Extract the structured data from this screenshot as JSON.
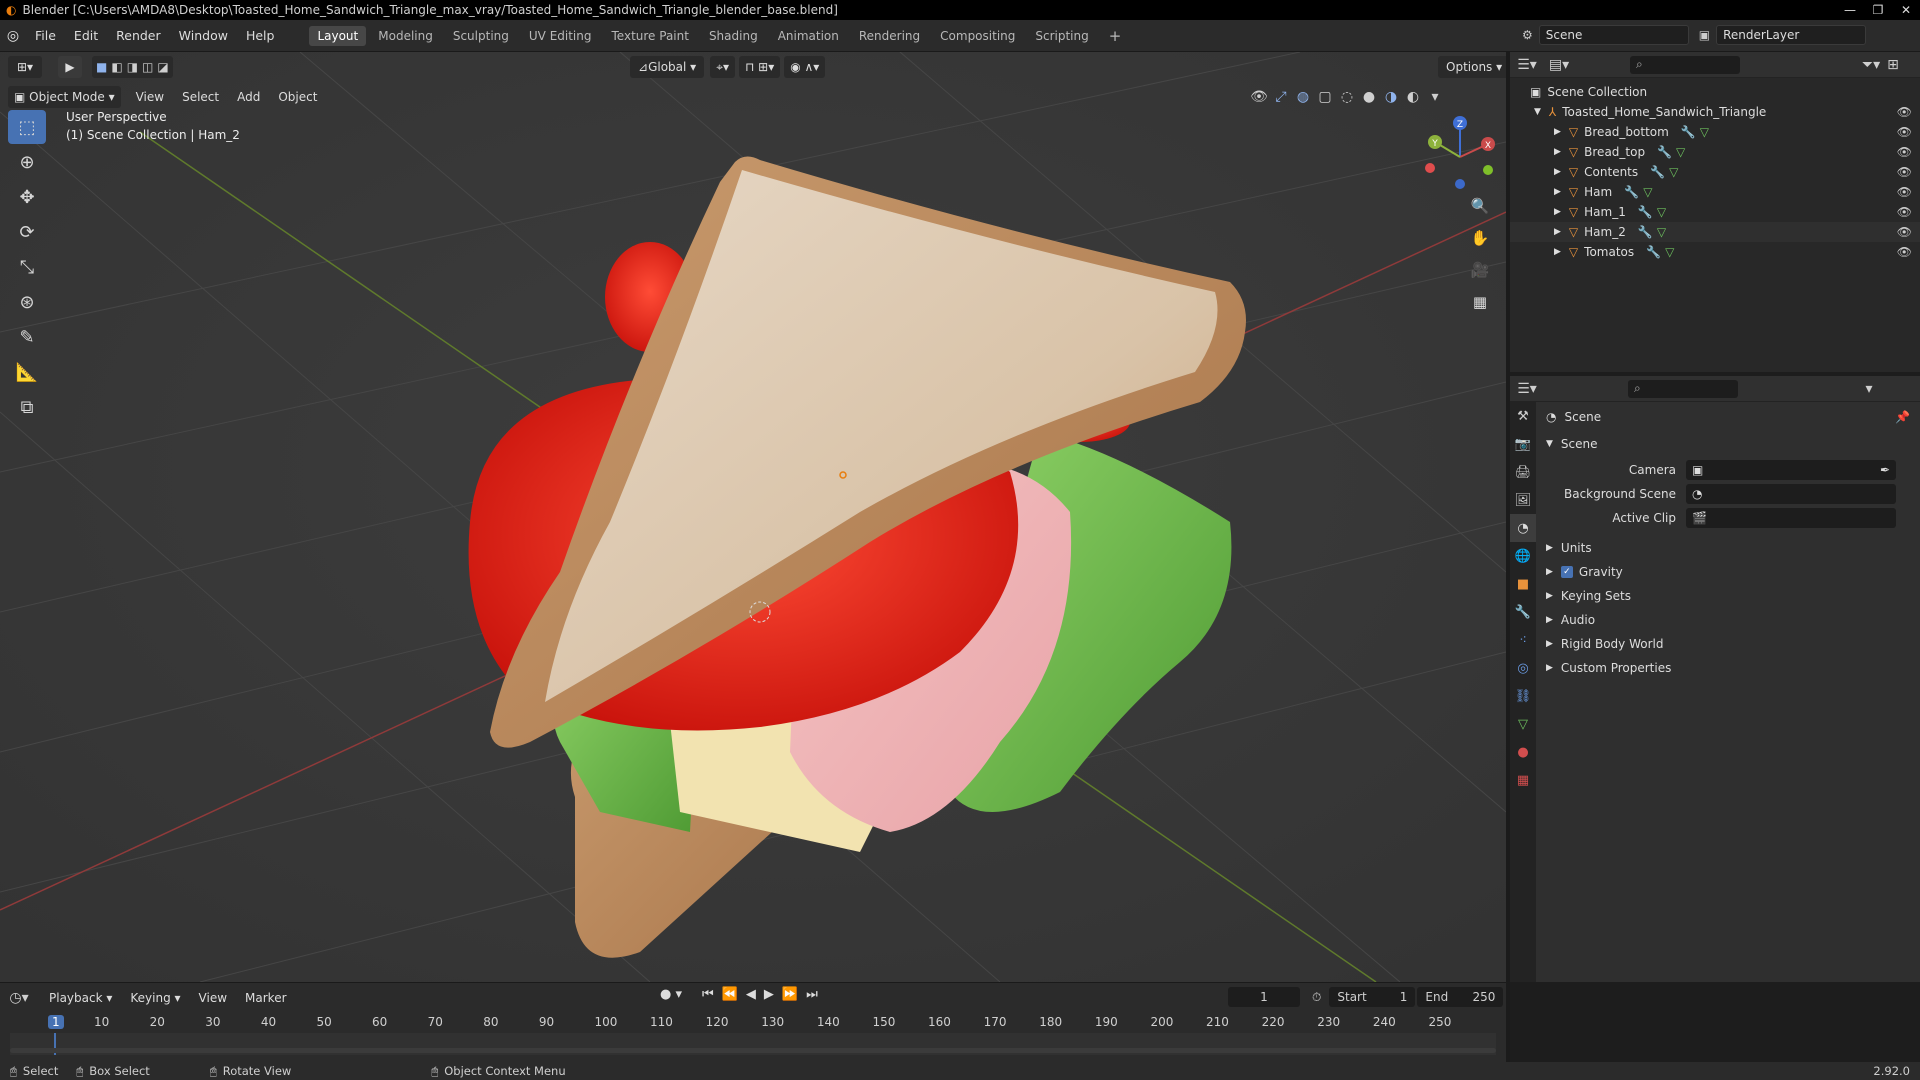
{
  "titlebar": {
    "title": "Blender [C:\\Users\\AMDA8\\Desktop\\Toasted_Home_Sandwich_Triangle_max_vray/Toasted_Home_Sandwich_Triangle_blender_base.blend]",
    "min": "—",
    "max": "❐",
    "close": "✕"
  },
  "menu": {
    "file": "File",
    "edit": "Edit",
    "render": "Render",
    "window": "Window",
    "help": "Help"
  },
  "workspaces": [
    "Layout",
    "Modeling",
    "Sculpting",
    "UV Editing",
    "Texture Paint",
    "Shading",
    "Animation",
    "Rendering",
    "Compositing",
    "Scripting"
  ],
  "scene_selector": {
    "label": "Scene"
  },
  "renderlayer_selector": {
    "label": "RenderLayer"
  },
  "viewport": {
    "mode": "Object Mode",
    "menus": {
      "view": "View",
      "select": "Select",
      "add": "Add",
      "object": "Object"
    },
    "orientation": "Global",
    "options": "Options",
    "info_line1": "User Perspective",
    "info_line2": "(1) Scene Collection | Ham_2",
    "gizmo": {
      "x": "X",
      "y": "Y",
      "z": "Z"
    }
  },
  "outliner": {
    "root": "Scene Collection",
    "collection": "Toasted_Home_Sandwich_Triangle",
    "objects": [
      "Bread_bottom",
      "Bread_top",
      "Contents",
      "Ham",
      "Ham_1",
      "Ham_2",
      "Tomatos"
    ]
  },
  "properties": {
    "header": "Scene",
    "panel": "Scene",
    "camera_label": "Camera",
    "bg_scene_label": "Background Scene",
    "active_clip_label": "Active Clip",
    "sections": [
      "Units",
      "Gravity",
      "Keying Sets",
      "Audio",
      "Rigid Body World",
      "Custom Properties"
    ]
  },
  "timeline": {
    "menus": {
      "playback": "Playback",
      "keying": "Keying",
      "view": "View",
      "marker": "Marker"
    },
    "current_frame": "1",
    "start_label": "Start",
    "start": "1",
    "end_label": "End",
    "end": "250",
    "ruler": [
      "1",
      "10",
      "20",
      "30",
      "40",
      "50",
      "60",
      "70",
      "80",
      "90",
      "100",
      "110",
      "120",
      "130",
      "140",
      "150",
      "160",
      "170",
      "180",
      "190",
      "200",
      "210",
      "220",
      "230",
      "240",
      "250"
    ]
  },
  "status": {
    "select": "Select",
    "box_select": "Box Select",
    "rotate_view": "Rotate View",
    "context_menu": "Object Context Menu",
    "version": "2.92.0"
  },
  "colors": {
    "accent": "#4772b3",
    "object_icon": "#e8923b",
    "x_axis": "#c94b4b",
    "y_axis": "#8db23c",
    "z_axis": "#3f6fd6"
  }
}
